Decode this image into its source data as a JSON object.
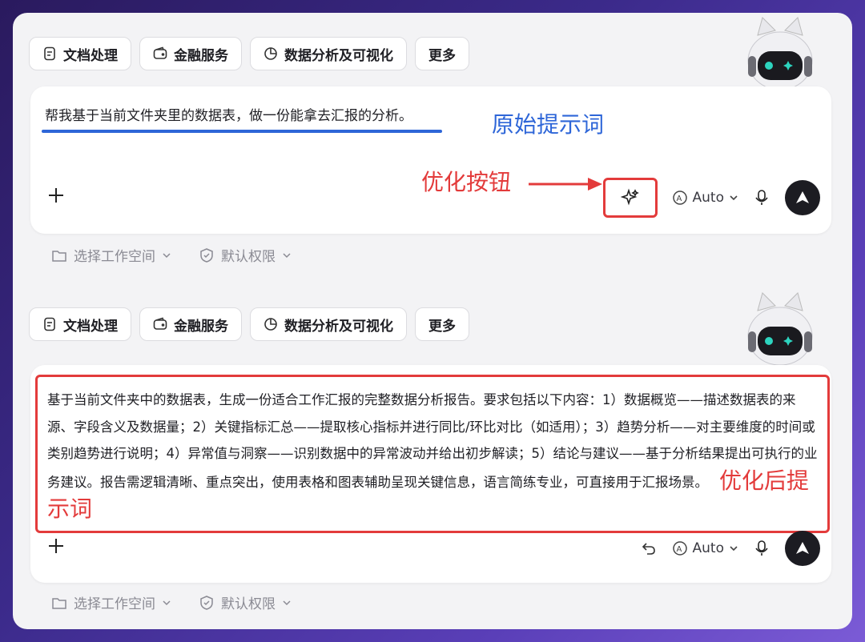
{
  "chips": [
    {
      "label": "文档处理",
      "icon": "document-icon"
    },
    {
      "label": "金融服务",
      "icon": "wallet-icon"
    },
    {
      "label": "数据分析及可视化",
      "icon": "pie-chart-icon"
    },
    {
      "label": "更多",
      "icon": ""
    }
  ],
  "original": {
    "prompt": "帮我基于当前文件夹里的数据表，做一份能拿去汇报的分析。",
    "annotation": "原始提示词",
    "optimize_annotation": "优化按钮"
  },
  "model_selector": "Auto",
  "meta": {
    "workspace": "选择工作空间",
    "permission": "默认权限"
  },
  "optimized": {
    "prompt": "基于当前文件夹中的数据表，生成一份适合工作汇报的完整数据分析报告。要求包括以下内容：1）数据概览——描述数据表的来源、字段含义及数据量；2）关键指标汇总——提取核心指标并进行同比/环比对比（如适用）；3）趋势分析——对主要维度的时间或类别趋势进行说明；4）异常值与洞察——识别数据中的异常波动并给出初步解读；5）结论与建议——基于分析结果提出可执行的业务建议。报告需逻辑清晰、重点突出，使用表格和图表辅助呈现关键信息，语言简练专业，可直接用于汇报场景。",
    "annotation": "优化后提示词"
  },
  "colors": {
    "annotation_red": "#e33b3b",
    "annotation_blue": "#2e66d8"
  }
}
